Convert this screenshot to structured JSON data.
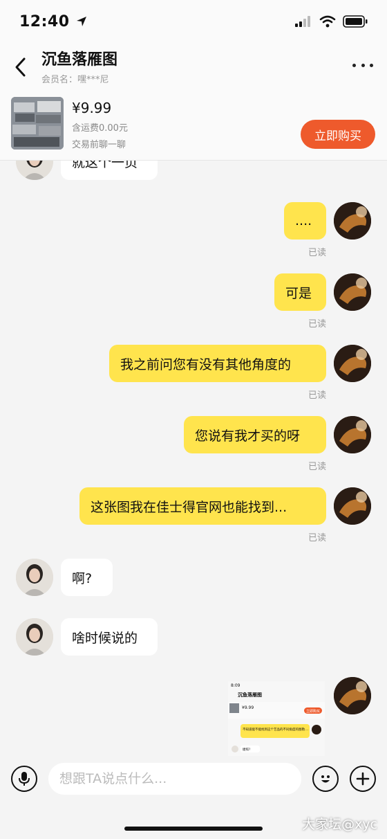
{
  "status_bar": {
    "time": "12:40"
  },
  "header": {
    "title": "沉鱼落雁图",
    "member": "会员名：嘿***尼"
  },
  "product": {
    "price": "¥9.99",
    "shipping": "含运费0.00元",
    "note": "交易前聊一聊",
    "buy_label": "立即购买"
  },
  "messages": [
    {
      "from": "seller",
      "text": "就这个一页"
    },
    {
      "from": "me",
      "text": "....",
      "read": "已读"
    },
    {
      "from": "me",
      "text": "可是",
      "read": "已读"
    },
    {
      "from": "me",
      "text": "我之前问您有没有其他角度的",
      "read": "已读"
    },
    {
      "from": "me",
      "text": "您说有我才买的呀",
      "read": "已读"
    },
    {
      "from": "me",
      "text": "这张图我在佳士得官网也能找到...",
      "read": "已读"
    },
    {
      "from": "seller",
      "text": "啊?"
    },
    {
      "from": "seller",
      "text": "啥时候说的"
    }
  ],
  "screenshot_preview": {
    "time": "8:09",
    "title": "沉鱼落雁图",
    "price": "¥9.99",
    "buy_label": "立即购买",
    "message": "不知道能不能找到这个艺品的不同角度的图勒....",
    "reply": "捷照?"
  },
  "input": {
    "placeholder": "想跟TA说点什么..."
  },
  "icons": [
    "back-arrow-icon",
    "more-dots-icon",
    "microphone-icon",
    "emoji-icon",
    "plus-icon",
    "signal-icon",
    "wifi-icon",
    "battery-icon",
    "location-arrow-icon"
  ],
  "watermark": "大家坛@xyc",
  "colors": {
    "accent_yellow": "#ffe44d",
    "buy_orange": "#ee5a2c",
    "background": "#f4f4f4"
  }
}
